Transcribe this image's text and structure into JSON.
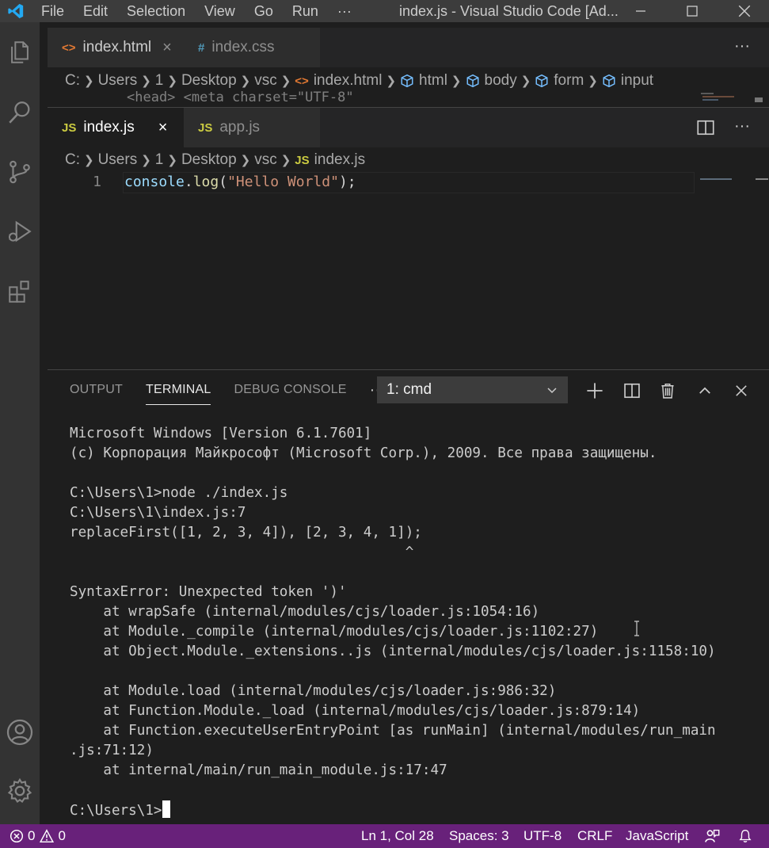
{
  "titlebar": {
    "menu": [
      "File",
      "Edit",
      "Selection",
      "View",
      "Go",
      "Run",
      "···"
    ],
    "title": "index.js - Visual Studio Code [Ad..."
  },
  "group1": {
    "tabs": [
      {
        "label": "index.html",
        "icon": "html-file-icon",
        "close": "×"
      },
      {
        "label": "index.css",
        "icon": "css-file-icon"
      }
    ],
    "more": "···",
    "breadcrumb": [
      "C:",
      "Users",
      "1",
      "Desktop",
      "vsc",
      "index.html",
      "html",
      "body",
      "form",
      "input"
    ],
    "peek_code": "    <head>              <meta charset=\"UTF-8\""
  },
  "group2": {
    "tabs": [
      {
        "label": "index.js",
        "icon": "JS",
        "close": "×"
      },
      {
        "label": "app.js",
        "icon": "JS"
      }
    ],
    "more": "···",
    "breadcrumb": [
      "C:",
      "Users",
      "1",
      "Desktop",
      "vsc",
      "index.js"
    ],
    "line_number": "1",
    "code": {
      "obj": "console",
      "dot": ".",
      "method": "log",
      "open": "(",
      "str": "\"Hello World\"",
      "close": ");"
    }
  },
  "panel": {
    "tabs": [
      "OUTPUT",
      "TERMINAL",
      "DEBUG CONSOLE"
    ],
    "more": "···",
    "terminal_select": "1: cmd",
    "terminal_lines": [
      "Microsoft Windows [Version 6.1.7601]",
      "(c) Корпорация Майкрософт (Microsoft Corp.), 2009. Все права защищены.",
      "",
      "C:\\Users\\1>node ./index.js",
      "C:\\Users\\1\\index.js:7",
      "replaceFirst([1, 2, 3, 4]), [2, 3, 4, 1]);",
      "                                        ^",
      "",
      "SyntaxError: Unexpected token ')'",
      "    at wrapSafe (internal/modules/cjs/loader.js:1054:16)",
      "    at Module._compile (internal/modules/cjs/loader.js:1102:27)",
      "    at Object.Module._extensions..js (internal/modules/cjs/loader.js:1158:10)",
      "",
      "    at Module.load (internal/modules/cjs/loader.js:986:32)",
      "    at Function.Module._load (internal/modules/cjs/loader.js:879:14)",
      "    at Function.executeUserEntryPoint [as runMain] (internal/modules/run_main",
      ".js:71:12)",
      "    at internal/main/run_main_module.js:17:47",
      ""
    ],
    "prompt": "C:\\Users\\1>"
  },
  "statusbar": {
    "errors": "0",
    "warnings": "0",
    "position": "Ln 1, Col 28",
    "spaces": "Spaces: 3",
    "encoding": "UTF-8",
    "eol": "CRLF",
    "language": "JavaScript"
  },
  "colors": {
    "statusbar": "#68217a",
    "activitybar": "#333333",
    "editor_bg": "#1e1e1e",
    "js_icon": "#cbcb41",
    "html_icon": "#e37933",
    "css_icon": "#519aba",
    "string": "#ce9178",
    "function": "#dcdcaa",
    "variable": "#9cdcfe"
  }
}
